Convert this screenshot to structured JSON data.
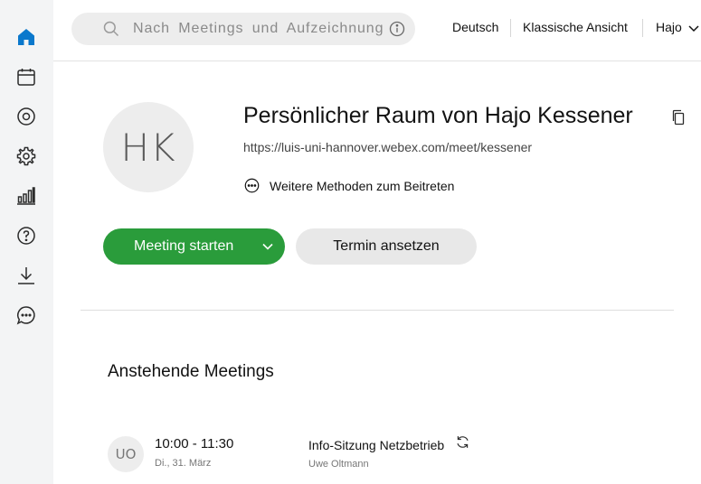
{
  "search": {
    "placeholder": "Nach Meetings und Aufzeichnungen suchen"
  },
  "topbar": {
    "language": "Deutsch",
    "classic_view": "Klassische Ansicht",
    "user": "Hajo"
  },
  "room": {
    "initials": "HK",
    "title": "Persönlicher Raum von Hajo Kessener",
    "url": "https://luis-uni-hannover.webex.com/meet/kessener",
    "more_methods": "Weitere Methoden zum Beitreten"
  },
  "actions": {
    "start": "Meeting starten",
    "schedule": "Termin ansetzen"
  },
  "upcoming": {
    "title": "Anstehende Meetings",
    "meetings": [
      {
        "initials": "UO",
        "time": "10:00 - 11:30",
        "date": "Di., 31. März",
        "title": "Info-Sitzung Netzbetrieb",
        "host": "Uwe Oltmann"
      }
    ]
  },
  "colors": {
    "accent_blue": "#0a78cc",
    "start_green": "#2a9c3b"
  },
  "icons": {
    "nav": [
      "home-icon",
      "calendar-icon",
      "record-icon",
      "gear-icon",
      "bar-chart-icon",
      "help-icon",
      "download-icon",
      "chat-icon"
    ]
  }
}
